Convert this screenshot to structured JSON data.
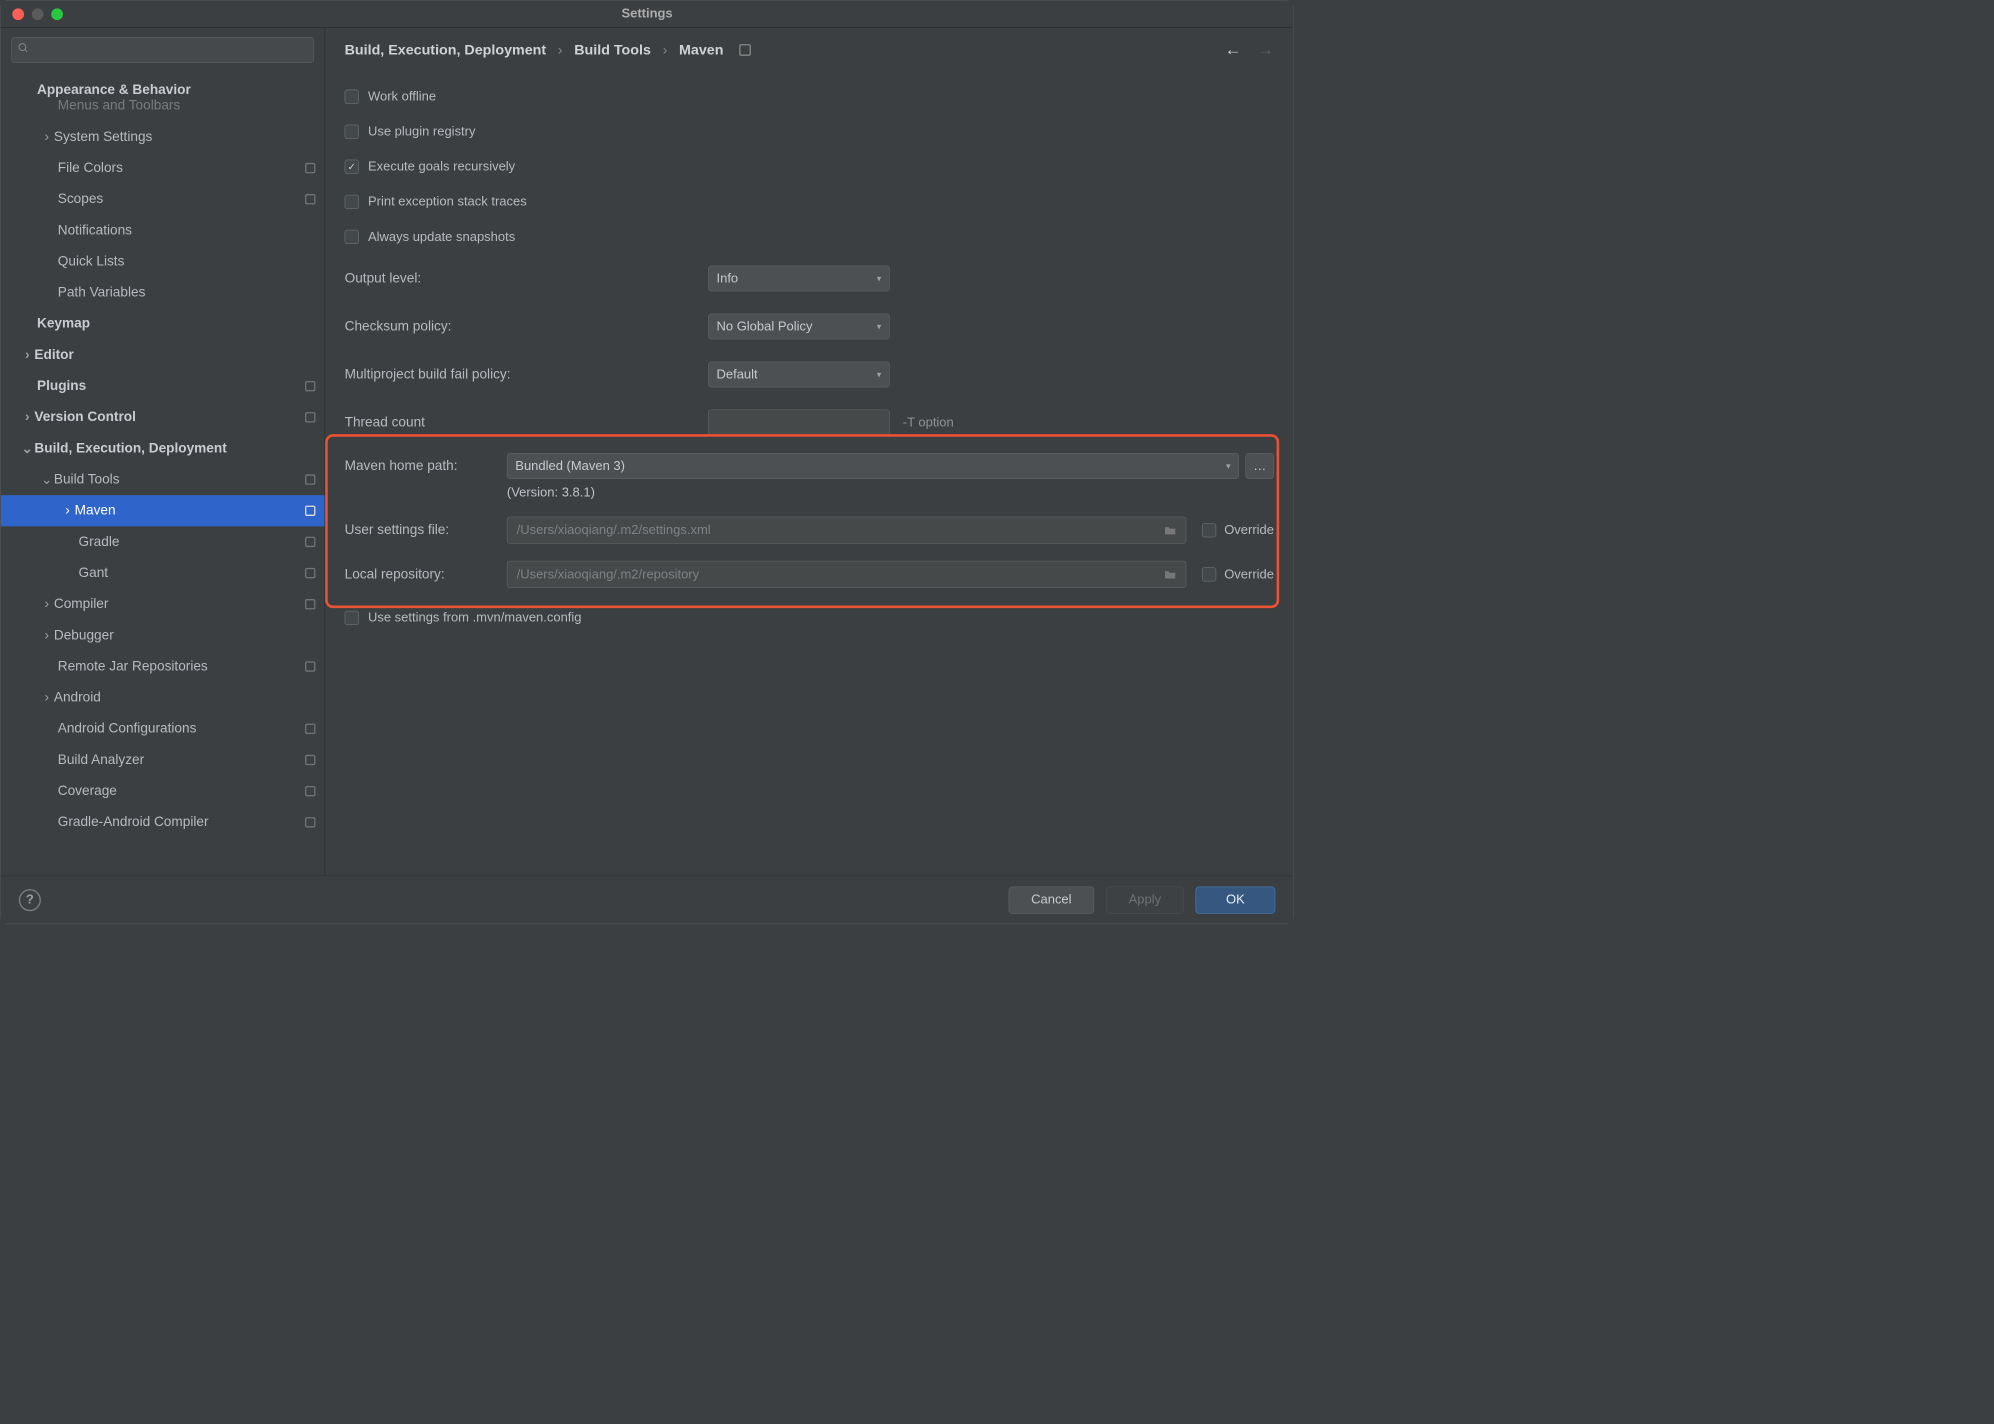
{
  "window": {
    "title": "Settings"
  },
  "search": {
    "placeholder": ""
  },
  "crumbs": [
    "Build, Execution, Deployment",
    "Build Tools",
    "Maven"
  ],
  "nav": {
    "back": "←",
    "fwd": "→"
  },
  "sidebar": {
    "appearance_behavior": "Appearance & Behavior",
    "menus_toolbars": "Menus and Toolbars",
    "system_settings": "System Settings",
    "file_colors": "File Colors",
    "scopes": "Scopes",
    "notifications": "Notifications",
    "quick_lists": "Quick Lists",
    "path_variables": "Path Variables",
    "keymap": "Keymap",
    "editor": "Editor",
    "plugins": "Plugins",
    "version_control": "Version Control",
    "bed": "Build, Execution, Deployment",
    "build_tools": "Build Tools",
    "maven": "Maven",
    "gradle": "Gradle",
    "gant": "Gant",
    "compiler": "Compiler",
    "debugger": "Debugger",
    "remote_jar": "Remote Jar Repositories",
    "android": "Android",
    "android_conf": "Android Configurations",
    "build_analyzer": "Build Analyzer",
    "coverage": "Coverage",
    "gradle_android": "Gradle-Android Compiler"
  },
  "form": {
    "work_offline": "Work offline",
    "use_plugin_registry": "Use plugin registry",
    "execute_recursively": "Execute goals recursively",
    "print_exception": "Print exception stack traces",
    "always_update": "Always update snapshots",
    "output_level": {
      "label": "Output level:",
      "value": "Info"
    },
    "checksum_policy": {
      "label": "Checksum policy:",
      "value": "No Global Policy"
    },
    "multiproject": {
      "label": "Multiproject build fail policy:",
      "value": "Default"
    },
    "thread_count": {
      "label": "Thread count",
      "value": "",
      "note": "-T option"
    },
    "maven_home": {
      "label": "Maven home path:",
      "value": "Bundled (Maven 3)",
      "version": "(Version: 3.8.1)"
    },
    "user_settings": {
      "label": "User settings file:",
      "value": "/Users/xiaoqiang/.m2/settings.xml",
      "override": "Override"
    },
    "local_repo": {
      "label": "Local repository:",
      "value": "/Users/xiaoqiang/.m2/repository",
      "override": "Override"
    },
    "use_mvn_config": "Use settings from .mvn/maven.config"
  },
  "buttons": {
    "cancel": "Cancel",
    "apply": "Apply",
    "ok": "OK"
  }
}
